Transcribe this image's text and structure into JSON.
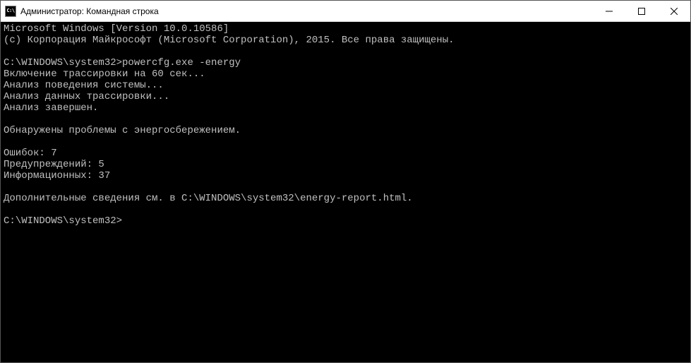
{
  "titlebar": {
    "icon_text": "C:\\",
    "title": "Администратор: Командная строка"
  },
  "terminal": {
    "lines": [
      "Microsoft Windows [Version 10.0.10586]",
      "(c) Корпорация Майкрософт (Microsoft Corporation), 2015. Все права защищены.",
      "",
      "C:\\WINDOWS\\system32>powercfg.exe -energy",
      "Включение трассировки на 60 сек...",
      "Анализ поведения системы...",
      "Анализ данных трассировки...",
      "Анализ завершен.",
      "",
      "Обнаружены проблемы с энергосбережением.",
      "",
      "Ошибок: 7",
      "Предупреждений: 5",
      "Информационных: 37",
      "",
      "Дополнительные сведения см. в C:\\WINDOWS\\system32\\energy-report.html.",
      "",
      "C:\\WINDOWS\\system32>"
    ]
  }
}
